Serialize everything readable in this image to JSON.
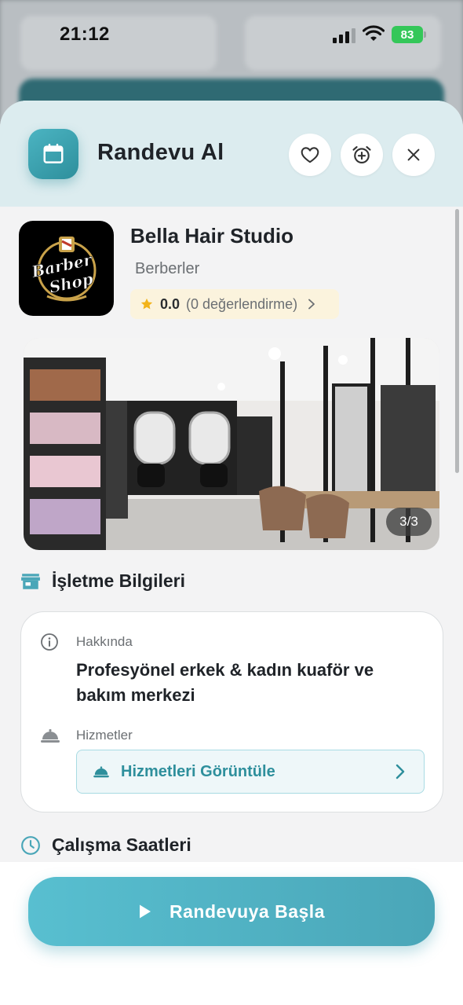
{
  "status": {
    "time": "21:12",
    "battery": "83"
  },
  "header": {
    "title": "Randevu Al"
  },
  "business": {
    "name": "Bella Hair Studio",
    "category": "Berberler",
    "rating": "0.0",
    "rating_count": "(0 değerlendirme)",
    "logo_text_1": "Barber",
    "logo_text_2": "Shop",
    "photo_counter": "3/3"
  },
  "info_section": {
    "title": "İşletme Bilgileri",
    "about_label": "Hakkında",
    "about_text": "Profesyönel erkek & kadın kuaför ve bakım merkezi",
    "services_label": "Hizmetler",
    "services_button": "Hizmetleri Görüntüle"
  },
  "hours_section": {
    "title": "Çalışma Saatleri"
  },
  "cta": {
    "label": "Randevuya Başla"
  },
  "colors": {
    "accent": "#2e8f9c",
    "cta": "#4aa6b8",
    "rating_bg": "#fbf3dd",
    "star": "#f2b31a"
  },
  "icons": [
    "calendar-icon",
    "heart-icon",
    "alarm-add-icon",
    "close-icon",
    "star-icon",
    "chevron-right-icon",
    "store-icon",
    "info-icon",
    "service-bell-icon",
    "clock-icon",
    "play-icon"
  ]
}
